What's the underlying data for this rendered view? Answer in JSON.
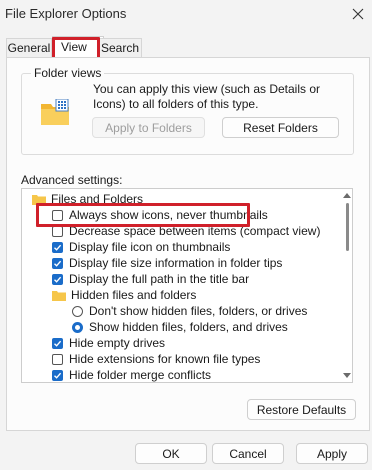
{
  "window": {
    "title": "File Explorer Options",
    "close_icon": "close-icon"
  },
  "tabs": [
    {
      "label": "General"
    },
    {
      "label": "View"
    },
    {
      "label": "Search"
    }
  ],
  "folder_views": {
    "legend": "Folder views",
    "description": "You can apply this view (such as Details or Icons) to all folders of this type.",
    "apply_button": "Apply to Folders",
    "reset_button": "Reset Folders"
  },
  "advanced": {
    "label": "Advanced settings:",
    "items": [
      {
        "type": "folder",
        "label": "Files and Folders"
      },
      {
        "type": "checkbox",
        "checked": false,
        "label": "Always show icons, never thumbnails"
      },
      {
        "type": "checkbox",
        "checked": false,
        "label": "Decrease space between items (compact view)"
      },
      {
        "type": "checkbox",
        "checked": true,
        "label": "Display file icon on thumbnails"
      },
      {
        "type": "checkbox",
        "checked": true,
        "label": "Display file size information in folder tips"
      },
      {
        "type": "checkbox",
        "checked": true,
        "label": "Display the full path in the title bar"
      },
      {
        "type": "folder",
        "label": "Hidden files and folders"
      },
      {
        "type": "radio",
        "checked": false,
        "label": "Don't show hidden files, folders, or drives"
      },
      {
        "type": "radio",
        "checked": true,
        "label": "Show hidden files, folders, and drives"
      },
      {
        "type": "checkbox",
        "checked": true,
        "label": "Hide empty drives"
      },
      {
        "type": "checkbox",
        "checked": false,
        "label": "Hide extensions for known file types"
      },
      {
        "type": "checkbox",
        "checked": true,
        "label": "Hide folder merge conflicts"
      }
    ],
    "restore_button": "Restore Defaults"
  },
  "footer": {
    "ok": "OK",
    "cancel": "Cancel",
    "apply": "Apply"
  },
  "colors": {
    "accent": "#1a6cc9",
    "highlight": "#d0202a",
    "folder": "#f6c64a"
  }
}
